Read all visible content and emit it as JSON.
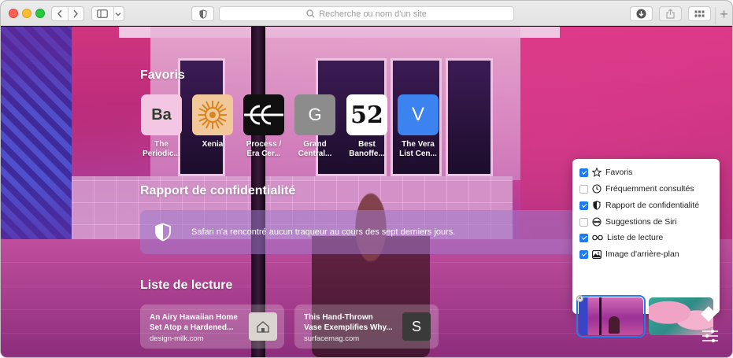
{
  "toolbar": {
    "address_placeholder": "Recherche ou nom d'un site",
    "new_tab_label": "+"
  },
  "favorites": {
    "title": "Favoris",
    "items": [
      {
        "tile_text": "Ba",
        "label": "The Periodic...",
        "tile_color": "#f3c7e3",
        "text_color": "#2f3e2f"
      },
      {
        "tile_text": "",
        "label": "Xenia",
        "tile_color": "#f0c89a",
        "text_color": "#d9841c"
      },
      {
        "tile_text": "",
        "label": "Process / Era Cer...",
        "tile_color": "#0f0f0f",
        "text_color": "#ffffff"
      },
      {
        "tile_text": "G",
        "label": "Grand Central...",
        "tile_color": "#8c8c8c",
        "text_color": "#ffffff"
      },
      {
        "tile_text": "52",
        "label": "Best Banoffe...",
        "tile_color": "#ffffff",
        "text_color": "#111111"
      },
      {
        "tile_text": "V",
        "label": "The Vera List Cen...",
        "tile_color": "#3d83f0",
        "text_color": "#ffffff"
      }
    ]
  },
  "privacy": {
    "title": "Rapport de confidentialité",
    "message": "Safari n'a rencontré aucun traqueur au cours des sept derniers jours."
  },
  "reading_list": {
    "title": "Liste de lecture",
    "items": [
      {
        "title_line1": "An Airy Hawaiian Home",
        "title_line2": "Set Atop a Hardened...",
        "site": "design-milk.com",
        "thumb_text": "",
        "thumb_color": "#d9d4cf"
      },
      {
        "title_line1": "This Hand-Thrown",
        "title_line2": "Vase Exemplifies Why...",
        "site": "surfacemag.com",
        "thumb_text": "S",
        "thumb_color": "#3a3a3a"
      }
    ]
  },
  "customize": {
    "options": [
      {
        "label": "Favoris",
        "checked": true,
        "icon": "star-icon"
      },
      {
        "label": "Fréquemment consultés",
        "checked": false,
        "icon": "clock-icon"
      },
      {
        "label": "Rapport de confidentialité",
        "checked": true,
        "icon": "shield-icon"
      },
      {
        "label": "Suggestions de Siri",
        "checked": false,
        "icon": "siri-icon"
      },
      {
        "label": "Liste de lecture",
        "checked": true,
        "icon": "glasses-icon"
      },
      {
        "label": "Image d'arrière-plan",
        "checked": true,
        "icon": "photo-icon"
      }
    ],
    "accent_color": "#1f7cf0"
  }
}
